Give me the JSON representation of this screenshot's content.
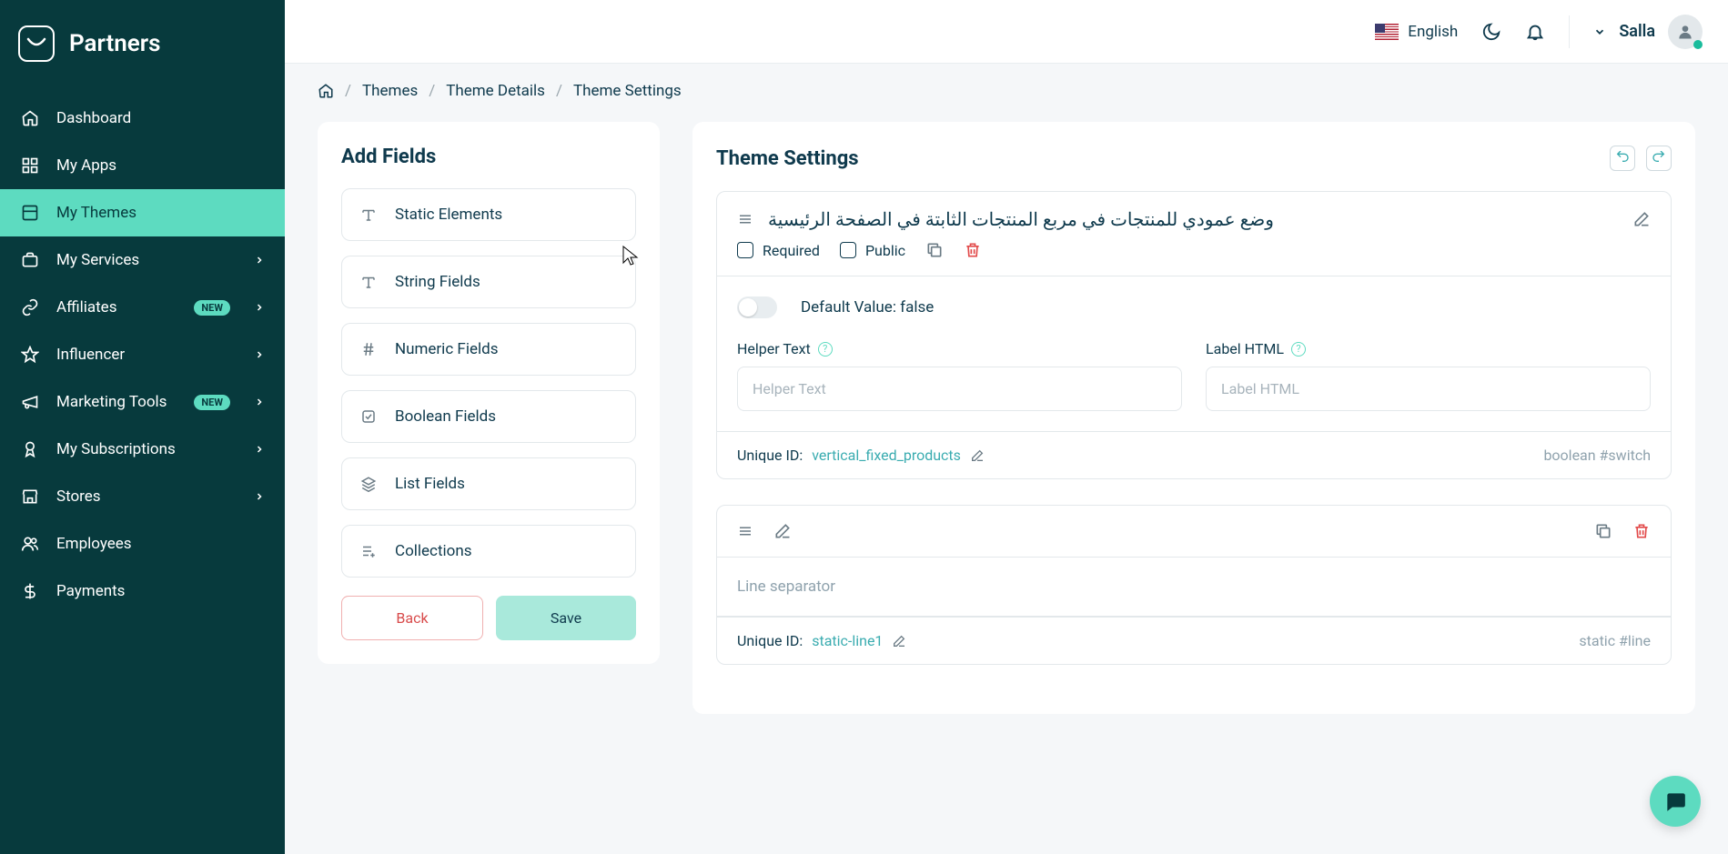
{
  "brand": "Partners",
  "sidebar": {
    "items": [
      {
        "label": "Dashboard"
      },
      {
        "label": "My Apps"
      },
      {
        "label": "My Themes"
      },
      {
        "label": "My Services"
      },
      {
        "label": "Affiliates",
        "badge": "NEW"
      },
      {
        "label": "Influencer"
      },
      {
        "label": "Marketing Tools",
        "badge": "NEW"
      },
      {
        "label": "My Subscriptions"
      },
      {
        "label": "Stores"
      },
      {
        "label": "Employees"
      },
      {
        "label": "Payments"
      }
    ]
  },
  "topbar": {
    "language": "English",
    "user": "Salla"
  },
  "breadcrumb": {
    "themes": "Themes",
    "details": "Theme Details",
    "settings": "Theme Settings"
  },
  "addFields": {
    "title": "Add Fields",
    "types": [
      "Static Elements",
      "String Fields",
      "Numeric Fields",
      "Boolean Fields",
      "List Fields",
      "Collections"
    ],
    "back": "Back",
    "save": "Save"
  },
  "themeSettings": {
    "title": "Theme Settings",
    "block1": {
      "title": "وضع عمودي للمنتجات في مربع المنتجات الثابتة في الصفحة الرئيسية",
      "required": "Required",
      "public": "Public",
      "defaultLabel": "Default Value: false",
      "helperLabel": "Helper Text",
      "helperPlaceholder": "Helper Text",
      "labelHtmlLabel": "Label HTML",
      "labelHtmlPlaceholder": "Label HTML",
      "uidLabel": "Unique ID:",
      "uidValue": "vertical_fixed_products",
      "typeTag": "boolean #switch"
    },
    "block2": {
      "desc": "Line separator",
      "uidLabel": "Unique ID:",
      "uidValue": "static-line1",
      "typeTag": "static #line"
    }
  }
}
